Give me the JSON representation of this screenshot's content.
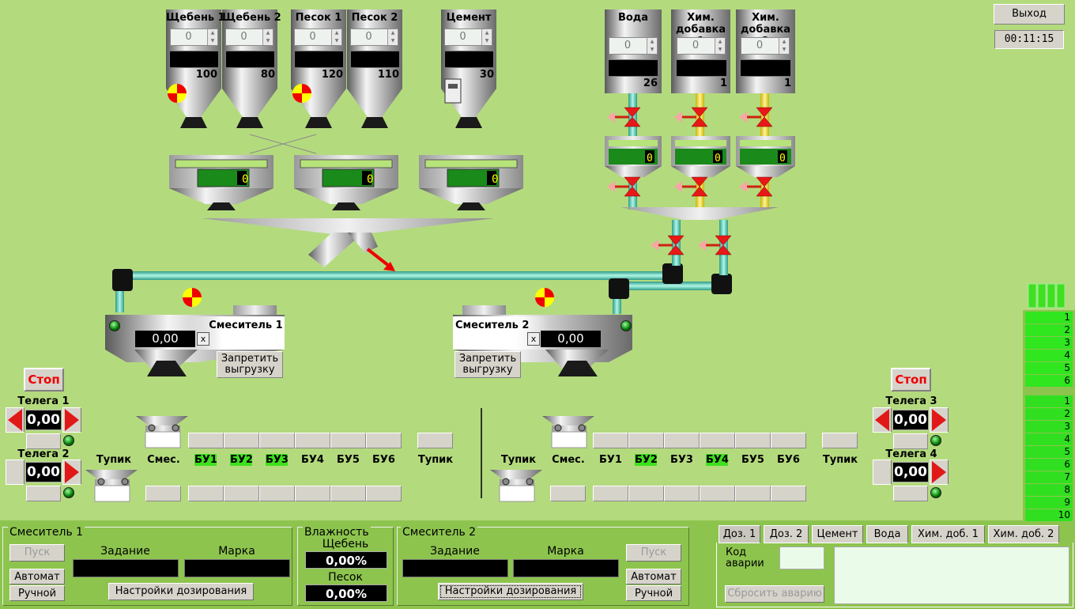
{
  "header": {
    "exit_label": "Выход",
    "clock": "00:11:15"
  },
  "silos": [
    {
      "name": "Щебень 1",
      "spin": "0",
      "amount": "100"
    },
    {
      "name": "Щебень 2",
      "spin": "0",
      "amount": "80"
    },
    {
      "name": "Песок 1",
      "spin": "0",
      "amount": "120"
    },
    {
      "name": "Песок 2",
      "spin": "0",
      "amount": "110"
    },
    {
      "name": "Цемент",
      "spin": "0",
      "amount": "30"
    }
  ],
  "liquids": [
    {
      "name": "Вода",
      "spin": "0",
      "amount": "26"
    },
    {
      "name": "Хим. добавка 1",
      "spin": "0",
      "amount": "1"
    },
    {
      "name": "Хим. добавка 2",
      "spin": "0",
      "amount": "1"
    }
  ],
  "mixers": [
    {
      "name": "Смеситель 1",
      "value": "0,00",
      "x_label": "x",
      "block_button": "Запретить выгрузку"
    },
    {
      "name": "Смеситель 2",
      "value": "0,00",
      "x_label": "x",
      "block_button": "Запретить выгрузку"
    }
  ],
  "carts": [
    {
      "name": "Телега 1",
      "value": "0,00"
    },
    {
      "name": "Телега 2",
      "value": "0,00"
    },
    {
      "name": "Телега 3",
      "value": "0,00"
    },
    {
      "name": "Телега 4",
      "value": "0,00"
    }
  ],
  "stop_label": "Стоп",
  "track_left": [
    {
      "label": "Тупик",
      "active": false
    },
    {
      "label": "Смес.",
      "active": false
    },
    {
      "label": "БУ1",
      "active": true
    },
    {
      "label": "БУ2",
      "active": true
    },
    {
      "label": "БУ3",
      "active": true
    },
    {
      "label": "БУ4",
      "active": false
    },
    {
      "label": "БУ5",
      "active": false
    },
    {
      "label": "БУ6",
      "active": false
    },
    {
      "label": "Тупик",
      "active": false
    }
  ],
  "track_right": [
    {
      "label": "Тупик",
      "active": false
    },
    {
      "label": "Смес.",
      "active": false
    },
    {
      "label": "БУ1",
      "active": false
    },
    {
      "label": "БУ2",
      "active": true
    },
    {
      "label": "БУ3",
      "active": false
    },
    {
      "label": "БУ4",
      "active": true
    },
    {
      "label": "БУ5",
      "active": false
    },
    {
      "label": "БУ6",
      "active": false
    },
    {
      "label": "Тупик",
      "active": false
    }
  ],
  "right_list_top": [
    "1",
    "2",
    "3",
    "4",
    "5",
    "6"
  ],
  "right_list_bottom": [
    "1",
    "2",
    "3",
    "4",
    "5",
    "6",
    "7",
    "8",
    "9",
    "10"
  ],
  "bottom": {
    "mixer1": {
      "title": "Смеситель 1",
      "start": "Пуск",
      "auto": "Автомат",
      "manual": "Ручной",
      "task_label": "Задание",
      "grade_label": "Марка",
      "settings": "Настройки дозирования"
    },
    "humidity": {
      "title": "Влажность",
      "gravel_label": "Щебень",
      "gravel_value": "0,00%",
      "sand_label": "Песок",
      "sand_value": "0,00%"
    },
    "mixer2": {
      "title": "Смеситель 2",
      "start": "Пуск",
      "auto": "Автомат",
      "manual": "Ручной",
      "task_label": "Задание",
      "grade_label": "Марка",
      "settings": "Настройки дозирования"
    },
    "tabs": [
      "Доз. 1",
      "Доз. 2",
      "Цемент",
      "Вода",
      "Хим. доб. 1",
      "Хим. доб. 2"
    ],
    "alarm_code_label": "Код аварии",
    "reset_alarm": "Сбросить аварию"
  }
}
